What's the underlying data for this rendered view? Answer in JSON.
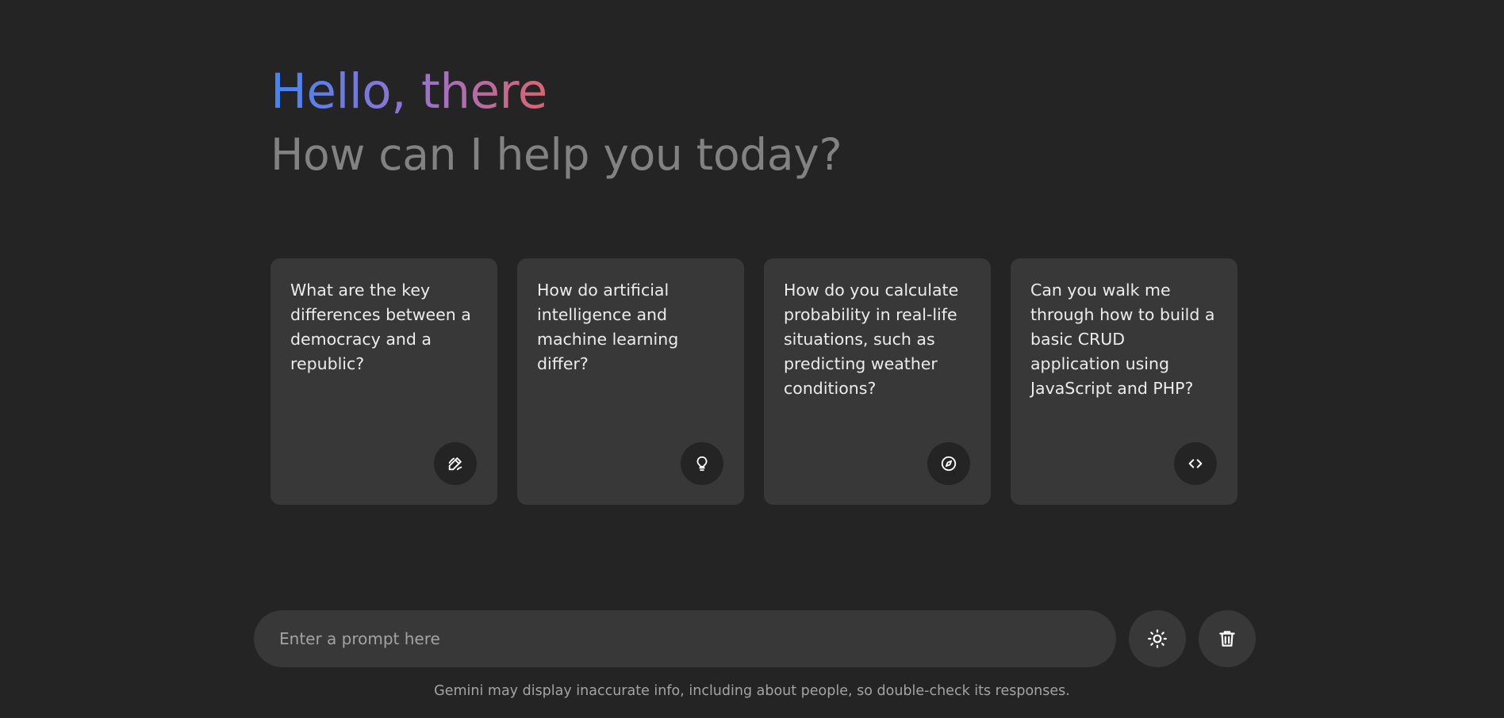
{
  "header": {
    "greeting": "Hello, there",
    "subtitle": "How can I help you today?"
  },
  "suggestions": [
    {
      "text": "What are the key differences between a democracy and a republic?",
      "icon": "draw-icon"
    },
    {
      "text": "How do artificial intelligence and machine learning differ?",
      "icon": "lightbulb-icon"
    },
    {
      "text": "How do you calculate probability in real-life situations, such as predicting weather conditions?",
      "icon": "explore-icon"
    },
    {
      "text": "Can you walk me through how to build a basic CRUD application using JavaScript and PHP?",
      "icon": "code-icon"
    }
  ],
  "typing": {
    "placeholder": "Enter a prompt here",
    "value": ""
  },
  "actions": {
    "theme_icon": "sun-icon",
    "delete_icon": "trash-icon"
  },
  "disclaimer": "Gemini may display inaccurate info, including about people, so double-check its responses.",
  "colors": {
    "background": "#242424",
    "card": "#383838",
    "gradient_start": "#4285f4",
    "gradient_mid": "#9b72cb",
    "gradient_end": "#d96570",
    "subtitle": "#828282"
  }
}
